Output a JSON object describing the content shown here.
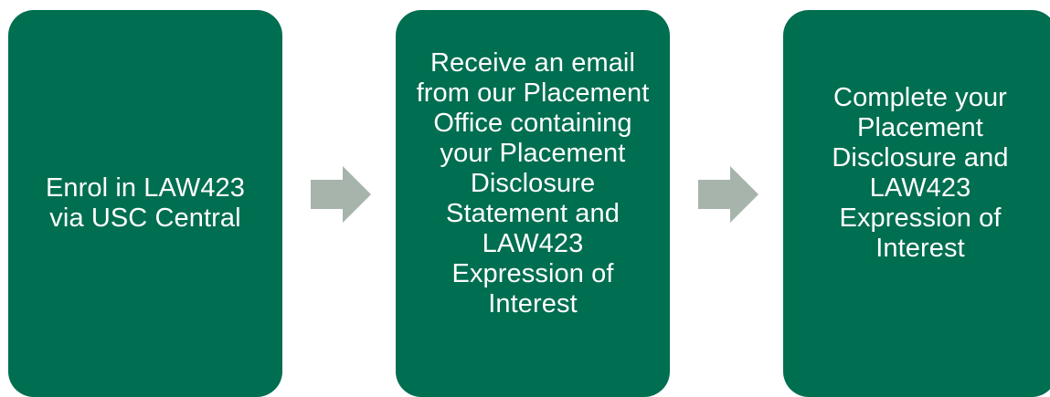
{
  "colors": {
    "box_fill": "#006e50",
    "arrow_fill": "#a7b4ac",
    "text": "#ffffff"
  },
  "steps": [
    {
      "text": "Enrol in LAW423 via USC Central"
    },
    {
      "text": "Receive an email from our Placement Office containing your Placement Disclosure Statement and LAW423 Expression of Interest"
    },
    {
      "text": "Complete your Placement Disclosure and LAW423 Expression of Interest"
    }
  ],
  "connectors": [
    {
      "shape": "arrow-right-icon",
      "from": 1,
      "to": 2
    },
    {
      "shape": "arrow-right-icon",
      "from": 2,
      "to": 3
    }
  ]
}
